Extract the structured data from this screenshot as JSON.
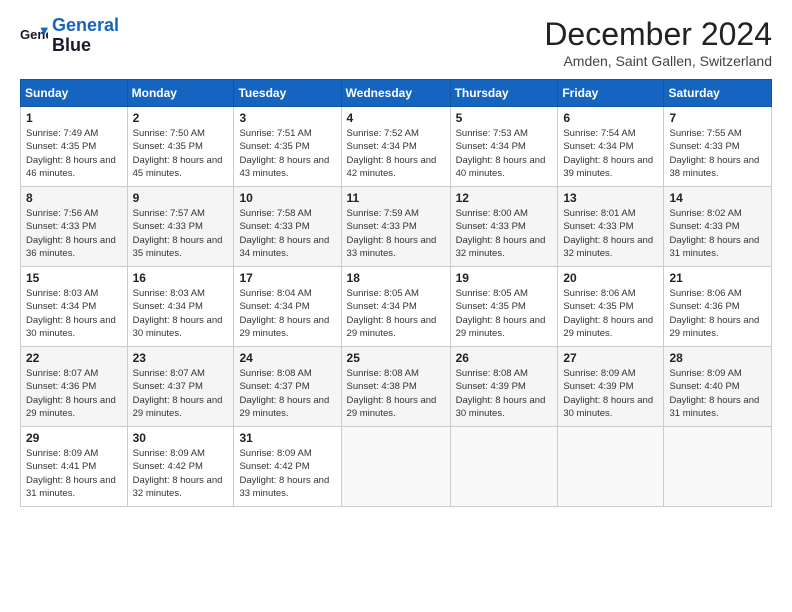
{
  "header": {
    "title": "December 2024",
    "location": "Amden, Saint Gallen, Switzerland"
  },
  "weekdays": [
    "Sunday",
    "Monday",
    "Tuesday",
    "Wednesday",
    "Thursday",
    "Friday",
    "Saturday"
  ],
  "days": [
    {
      "day": "",
      "sunrise": "",
      "sunset": "",
      "daylight": ""
    },
    {
      "day": "2",
      "sunrise": "7:50 AM",
      "sunset": "4:35 PM",
      "daylight": "8 hours and 45 minutes."
    },
    {
      "day": "3",
      "sunrise": "7:51 AM",
      "sunset": "4:35 PM",
      "daylight": "8 hours and 43 minutes."
    },
    {
      "day": "4",
      "sunrise": "7:52 AM",
      "sunset": "4:34 PM",
      "daylight": "8 hours and 42 minutes."
    },
    {
      "day": "5",
      "sunrise": "7:53 AM",
      "sunset": "4:34 PM",
      "daylight": "8 hours and 40 minutes."
    },
    {
      "day": "6",
      "sunrise": "7:54 AM",
      "sunset": "4:34 PM",
      "daylight": "8 hours and 39 minutes."
    },
    {
      "day": "7",
      "sunrise": "7:55 AM",
      "sunset": "4:33 PM",
      "daylight": "8 hours and 38 minutes."
    },
    {
      "day": "8",
      "sunrise": "7:56 AM",
      "sunset": "4:33 PM",
      "daylight": "8 hours and 36 minutes."
    },
    {
      "day": "9",
      "sunrise": "7:57 AM",
      "sunset": "4:33 PM",
      "daylight": "8 hours and 35 minutes."
    },
    {
      "day": "10",
      "sunrise": "7:58 AM",
      "sunset": "4:33 PM",
      "daylight": "8 hours and 34 minutes."
    },
    {
      "day": "11",
      "sunrise": "7:59 AM",
      "sunset": "4:33 PM",
      "daylight": "8 hours and 33 minutes."
    },
    {
      "day": "12",
      "sunrise": "8:00 AM",
      "sunset": "4:33 PM",
      "daylight": "8 hours and 32 minutes."
    },
    {
      "day": "13",
      "sunrise": "8:01 AM",
      "sunset": "4:33 PM",
      "daylight": "8 hours and 32 minutes."
    },
    {
      "day": "14",
      "sunrise": "8:02 AM",
      "sunset": "4:33 PM",
      "daylight": "8 hours and 31 minutes."
    },
    {
      "day": "15",
      "sunrise": "8:03 AM",
      "sunset": "4:34 PM",
      "daylight": "8 hours and 30 minutes."
    },
    {
      "day": "16",
      "sunrise": "8:03 AM",
      "sunset": "4:34 PM",
      "daylight": "8 hours and 30 minutes."
    },
    {
      "day": "17",
      "sunrise": "8:04 AM",
      "sunset": "4:34 PM",
      "daylight": "8 hours and 29 minutes."
    },
    {
      "day": "18",
      "sunrise": "8:05 AM",
      "sunset": "4:34 PM",
      "daylight": "8 hours and 29 minutes."
    },
    {
      "day": "19",
      "sunrise": "8:05 AM",
      "sunset": "4:35 PM",
      "daylight": "8 hours and 29 minutes."
    },
    {
      "day": "20",
      "sunrise": "8:06 AM",
      "sunset": "4:35 PM",
      "daylight": "8 hours and 29 minutes."
    },
    {
      "day": "21",
      "sunrise": "8:06 AM",
      "sunset": "4:36 PM",
      "daylight": "8 hours and 29 minutes."
    },
    {
      "day": "22",
      "sunrise": "8:07 AM",
      "sunset": "4:36 PM",
      "daylight": "8 hours and 29 minutes."
    },
    {
      "day": "23",
      "sunrise": "8:07 AM",
      "sunset": "4:37 PM",
      "daylight": "8 hours and 29 minutes."
    },
    {
      "day": "24",
      "sunrise": "8:08 AM",
      "sunset": "4:37 PM",
      "daylight": "8 hours and 29 minutes."
    },
    {
      "day": "25",
      "sunrise": "8:08 AM",
      "sunset": "4:38 PM",
      "daylight": "8 hours and 29 minutes."
    },
    {
      "day": "26",
      "sunrise": "8:08 AM",
      "sunset": "4:39 PM",
      "daylight": "8 hours and 30 minutes."
    },
    {
      "day": "27",
      "sunrise": "8:09 AM",
      "sunset": "4:39 PM",
      "daylight": "8 hours and 30 minutes."
    },
    {
      "day": "28",
      "sunrise": "8:09 AM",
      "sunset": "4:40 PM",
      "daylight": "8 hours and 31 minutes."
    },
    {
      "day": "29",
      "sunrise": "8:09 AM",
      "sunset": "4:41 PM",
      "daylight": "8 hours and 31 minutes."
    },
    {
      "day": "30",
      "sunrise": "8:09 AM",
      "sunset": "4:42 PM",
      "daylight": "8 hours and 32 minutes."
    },
    {
      "day": "31",
      "sunrise": "8:09 AM",
      "sunset": "4:42 PM",
      "daylight": "8 hours and 33 minutes."
    }
  ],
  "special": {
    "day1": {
      "day": "1",
      "sunrise": "7:49 AM",
      "sunset": "4:35 PM",
      "daylight": "8 hours and 46 minutes."
    }
  }
}
